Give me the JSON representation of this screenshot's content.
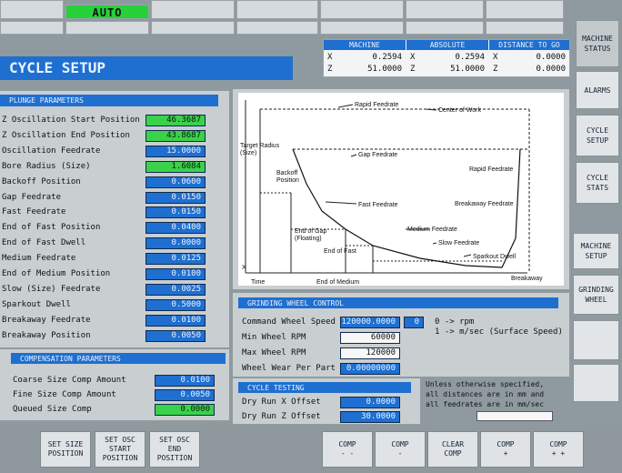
{
  "status": {
    "mode": "AUTO"
  },
  "page_title": "CYCLE SETUP",
  "positions": {
    "headers": [
      "MACHINE",
      "ABSOLUTE",
      "DISTANCE TO GO"
    ],
    "rows": [
      {
        "axis": "X",
        "machine": "0.2594",
        "absolute": "0.2594",
        "distance": "0.0000"
      },
      {
        "axis": "Z",
        "machine": "51.0000",
        "absolute": "51.0000",
        "distance": "0.0000"
      }
    ]
  },
  "side_buttons": [
    "MACHINE\nSTATUS",
    "ALARMS",
    "CYCLE\nSETUP",
    "CYCLE\nSTATS",
    "MACHINE\nSETUP",
    "GRINDING\nWHEEL",
    "",
    ""
  ],
  "plunge": {
    "title": "PLUNGE PARAMETERS",
    "params": [
      {
        "label": "Z Oscillation Start Position",
        "value": "46.3687",
        "color": "green"
      },
      {
        "label": "Z Oscillation End Position",
        "value": "43.8687",
        "color": "green"
      },
      {
        "label": "Oscillation Feedrate",
        "value": "15.0000",
        "color": "blue"
      },
      {
        "label": "Bore Radius (Size)",
        "value": "1.6084",
        "color": "green"
      },
      {
        "label": "Backoff Position",
        "value": "0.0600",
        "color": "blue"
      },
      {
        "label": "Gap Feedrate",
        "value": "0.0150",
        "color": "blue"
      },
      {
        "label": "Fast Feedrate",
        "value": "0.0150",
        "color": "blue"
      },
      {
        "label": "End of Fast Position",
        "value": "0.0400",
        "color": "blue"
      },
      {
        "label": "End of Fast Dwell",
        "value": "0.0000",
        "color": "blue"
      },
      {
        "label": "Medium Feedrate",
        "value": "0.0125",
        "color": "blue"
      },
      {
        "label": "End of Medium Position",
        "value": "0.0100",
        "color": "blue"
      },
      {
        "label": "Slow (Size) Feedrate",
        "value": "0.0025",
        "color": "blue"
      },
      {
        "label": "Sparkout Dwell",
        "value": "0.5000",
        "color": "blue"
      },
      {
        "label": "Breakaway Feedrate",
        "value": "0.0100",
        "color": "blue"
      },
      {
        "label": "Breakaway Position",
        "value": "0.0050",
        "color": "blue"
      }
    ]
  },
  "compensation": {
    "title": "COMPENSATION PARAMETERS",
    "params": [
      {
        "label": "Coarse Size Comp Amount",
        "value": "0.0100",
        "color": "blue"
      },
      {
        "label": "Fine Size Comp Amount",
        "value": "0.0050",
        "color": "blue"
      },
      {
        "label": "Queued Size Comp",
        "value": "0.0000",
        "color": "green"
      }
    ]
  },
  "diagram": {
    "labels": {
      "rapid_feedrate": "Rapid Feedrate",
      "center_of_work": "Center of Work",
      "target_radius": "Target Radius\n(Size)",
      "gap_feedrate": "Gap Feedrate",
      "backoff_position": "Backoff\nPosition",
      "rapid_feedrate_right": "Rapid Feedrate",
      "fast_feedrate": "Fast Feedrate",
      "breakaway_feedrate": "Breakaway Feedrate",
      "medium_feedrate": "Medium Feedrate",
      "end_of_gap": "End of Gap\n(Floating)",
      "slow_feedrate": "Slow Feedrate",
      "end_of_fast": "End of Fast",
      "sparkout_dwell": "Sparkout Dwell",
      "x_axis": "X",
      "time": "Time",
      "end_of_medium": "End of Medium",
      "breakaway": "Breakaway"
    }
  },
  "grinding_wheel": {
    "title": "GRINDING WHEEL CONTROL",
    "command_speed_label": "Command Wheel Speed",
    "command_speed_value": "120000.0000",
    "mode_value": "0",
    "mode_legend_0": "0 -> rpm",
    "mode_legend_1": "1 -> m/sec (Surface Speed)",
    "min_rpm_label": "Min Wheel RPM",
    "min_rpm_value": "60000",
    "max_rpm_label": "Max Wheel RPM",
    "max_rpm_value": "120000",
    "wear_label": "Wheel Wear Per Part",
    "wear_value": "0.00000000"
  },
  "cycle_testing": {
    "title": "CYCLE TESTING",
    "x_offset_label": "Dry Run X Offset",
    "x_offset_value": "0.0000",
    "z_offset_label": "Dry Run Z Offset",
    "z_offset_value": "30.0000"
  },
  "note": "Unless otherwise specified,\nall distances are in mm and\nall feedrates are in mm/sec",
  "bottom_buttons": [
    "SET SIZE\nPOSITION",
    "SET OSC\nSTART\nPOSITION",
    "SET OSC\nEND\nPOSITION",
    "COMP\n- -",
    "COMP\n-",
    "CLEAR\nCOMP",
    "COMP\n+",
    "COMP\n+ +"
  ]
}
